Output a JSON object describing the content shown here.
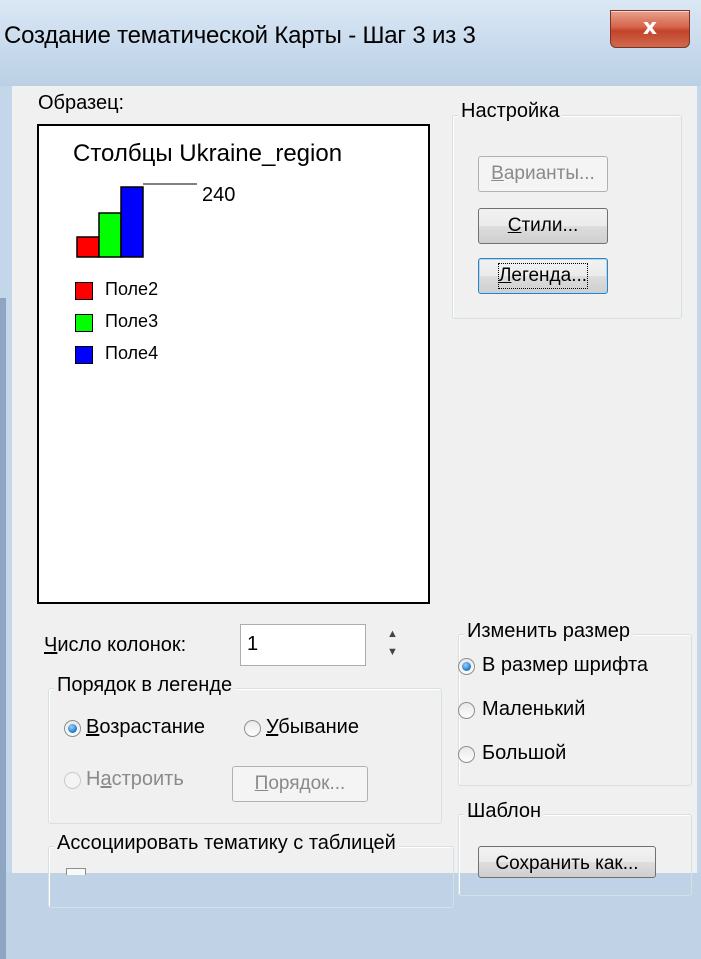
{
  "window": {
    "title": "Создание тематической Карты - Шаг 3 из 3",
    "close_glyph": "x"
  },
  "preview": {
    "label": "Образец:",
    "title": "Столбцы Ukraine_region",
    "value_label": "240",
    "legend": [
      {
        "label": "Поле2",
        "color": "#ff0000"
      },
      {
        "label": "Поле3",
        "color": "#00ff00"
      },
      {
        "label": "Поле4",
        "color": "#0000ff"
      }
    ]
  },
  "settings": {
    "title": "Настройка",
    "variants_mn": "В",
    "variants_rest": "арианты...",
    "styles_mn": "С",
    "styles_rest": "тили...",
    "legend_mn": "Л",
    "legend_rest": "егенда..."
  },
  "columns": {
    "label_mn": "Ч",
    "label_rest": "исло колонок:",
    "value": "1"
  },
  "legend_order": {
    "title": "Порядок в легенде",
    "ascending_mn": "В",
    "ascending_rest": "озрастание",
    "descending_mn": "У",
    "descending_rest": "бывание",
    "custom_pre": "Н",
    "custom_mn": "а",
    "custom_rest": "строить",
    "order_mn": "П",
    "order_rest": "орядок..."
  },
  "resize": {
    "title": "Изменить размер",
    "options": [
      "В размер шрифта",
      "Маленький",
      "Большой"
    ],
    "selected": "В размер шрифта"
  },
  "template": {
    "title": "Шаблон",
    "save_as_label": "Сохранить как..."
  },
  "associate": {
    "title": "Ассоциировать тематику с таблицей"
  }
}
